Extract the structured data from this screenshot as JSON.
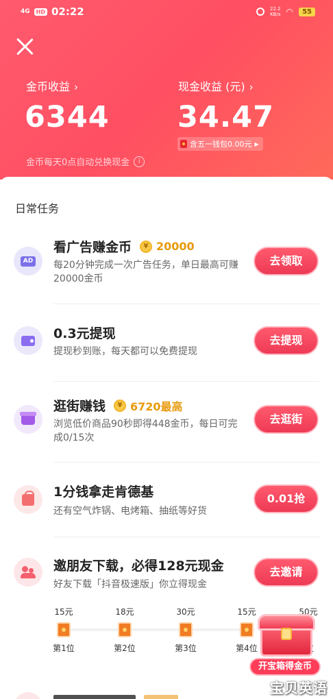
{
  "status_bar": {
    "network": "4G",
    "hd": "HD",
    "time": "02:22",
    "speed_value": "22.2",
    "speed_unit": "KB/s",
    "battery": "55"
  },
  "header": {
    "coin_label": "金币收益",
    "coin_value": "6344",
    "cash_label": "现金收益 (元)",
    "cash_value": "34.47",
    "wallet_chip": "含五一钱包0.00元",
    "exchange_note": "金币每天0点自动兑换现金",
    "info_icon": "i"
  },
  "daily_tasks": {
    "title": "日常任务",
    "items": [
      {
        "icon": "ad-icon",
        "icon_text": "AD",
        "title": "看广告赚金币",
        "reward": "20000",
        "desc": "每20分钟完成一次广告任务，单日最高可赚20000金币",
        "button": "去领取"
      },
      {
        "icon": "wallet-icon",
        "title": "0.3元提现",
        "desc": "提现秒到账，每天都可以免费提现",
        "button": "去提现"
      },
      {
        "icon": "shop-icon",
        "title": "逛街赚钱",
        "reward": "6720最高",
        "desc": "浏览低价商品90秒即得448金币，每日可完成0/15次",
        "button": "去逛街"
      },
      {
        "icon": "bag-icon",
        "title": "1分钱拿走肯德基",
        "desc": "还有空气炸锅、电烤箱、抽纸等好货",
        "button": "0.01抢"
      },
      {
        "icon": "friends-icon",
        "title": "邀朋友下载，必得128元现金",
        "desc": "好友下载「抖音极速版」你立得现金",
        "button": "去邀请"
      }
    ],
    "invite_ladder": [
      {
        "amount": "15元",
        "rank": "第1位"
      },
      {
        "amount": "18元",
        "rank": "第2位"
      },
      {
        "amount": "30元",
        "rank": "第3位"
      },
      {
        "amount": "15元",
        "rank": "第4位"
      },
      {
        "amount": "50元",
        "rank": "位"
      }
    ],
    "coin_symbol": "¥"
  },
  "treasure_chest": {
    "button": "开宝箱得金币"
  },
  "watermark": "宝贝英语",
  "colors": {
    "brand": "#ff4f62",
    "reward": "#e79a0c",
    "button": "#ee3a55"
  }
}
